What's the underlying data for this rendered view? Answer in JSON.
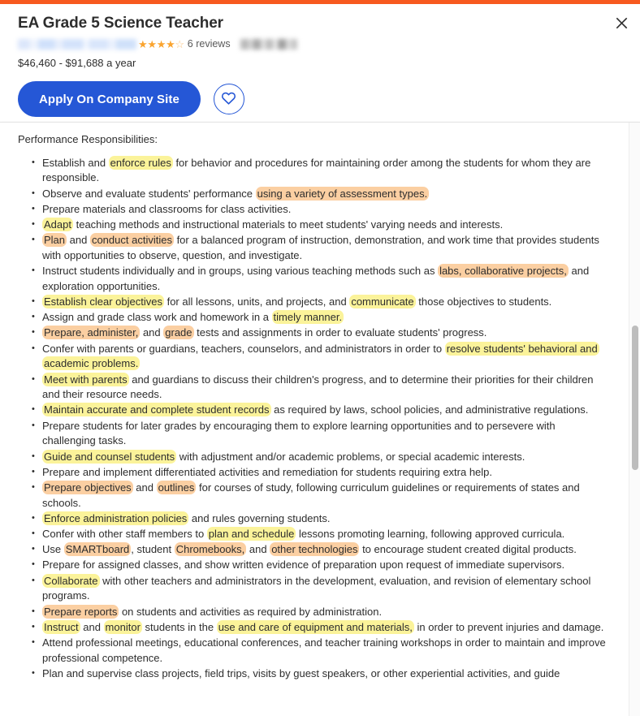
{
  "header": {
    "accent_color": "#f7591f",
    "job_title": "EA Grade 5 Science Teacher",
    "company_name_redacted": "",
    "location_redacted": "",
    "rating_stars": "★★★★",
    "rating_empty_star": "☆",
    "reviews_label": "6 reviews",
    "salary": "$46,460 - $91,688 a year",
    "apply_label": "Apply On Company Site",
    "apply_color": "#2557d6",
    "save_icon": "heart-icon",
    "close_icon": "close-icon"
  },
  "description": {
    "heading": "Performance Responsibilities:",
    "highlight_yellow": "#fbf39a",
    "highlight_orange": "#fbcfa2",
    "bullets": [
      [
        {
          "t": "Establish and ",
          "h": "none"
        },
        {
          "t": "enforce rules",
          "h": "yellow"
        },
        {
          "t": " for behavior and procedures for maintaining order among the students for whom they are responsible.",
          "h": "none"
        }
      ],
      [
        {
          "t": "Observe and evaluate students' performance ",
          "h": "none"
        },
        {
          "t": "using a variety of assessment types.",
          "h": "orange"
        }
      ],
      [
        {
          "t": "Prepare materials and classrooms for class activities.",
          "h": "none"
        }
      ],
      [
        {
          "t": "Adapt",
          "h": "yellow"
        },
        {
          "t": " teaching methods and instructional materials to meet students' varying needs and interests.",
          "h": "none"
        }
      ],
      [
        {
          "t": "Plan",
          "h": "orange"
        },
        {
          "t": " and ",
          "h": "none"
        },
        {
          "t": "conduct activities",
          "h": "orange"
        },
        {
          "t": " for a balanced program of instruction, demonstration, and work time that provides students with opportunities to observe, question, and investigate.",
          "h": "none"
        }
      ],
      [
        {
          "t": "Instruct students individually and in groups, using various teaching methods such as ",
          "h": "none"
        },
        {
          "t": "labs, collaborative projects,",
          "h": "orange"
        },
        {
          "t": " and exploration opportunities.",
          "h": "none"
        }
      ],
      [
        {
          "t": "Establish clear objectives",
          "h": "yellow"
        },
        {
          "t": " for all lessons, units, and projects, and ",
          "h": "none"
        },
        {
          "t": "communicate",
          "h": "yellow"
        },
        {
          "t": " those objectives to students.",
          "h": "none"
        }
      ],
      [
        {
          "t": "Assign and grade class work and homework in a ",
          "h": "none"
        },
        {
          "t": "timely manner.",
          "h": "yellow"
        }
      ],
      [
        {
          "t": "Prepare, administer,",
          "h": "orange"
        },
        {
          "t": " and ",
          "h": "none"
        },
        {
          "t": "grade",
          "h": "orange"
        },
        {
          "t": " tests and assignments in order to evaluate students' progress.",
          "h": "none"
        }
      ],
      [
        {
          "t": "Confer with parents or guardians, teachers, counselors, and administrators in order to ",
          "h": "none"
        },
        {
          "t": "resolve students' behavioral and academic problems.",
          "h": "yellow"
        }
      ],
      [
        {
          "t": "Meet with parents",
          "h": "yellow"
        },
        {
          "t": " and guardians to discuss their children's progress, and to determine their priorities for their children and their resource needs.",
          "h": "none"
        }
      ],
      [
        {
          "t": "Maintain accurate and complete student records",
          "h": "yellow"
        },
        {
          "t": " as required by laws, school policies, and administrative regulations.",
          "h": "none"
        }
      ],
      [
        {
          "t": "Prepare students for later grades by encouraging them to explore learning opportunities and to persevere with challenging tasks.",
          "h": "none"
        }
      ],
      [
        {
          "t": "Guide and counsel students",
          "h": "yellow"
        },
        {
          "t": " with adjustment and/or academic problems, or special academic interests.",
          "h": "none"
        }
      ],
      [
        {
          "t": "Prepare and implement differentiated activities and remediation for students requiring extra help.",
          "h": "none"
        }
      ],
      [
        {
          "t": "Prepare objectives",
          "h": "orange"
        },
        {
          "t": " and ",
          "h": "none"
        },
        {
          "t": "outlines",
          "h": "orange"
        },
        {
          "t": " for courses of study, following curriculum guidelines or requirements of states and schools.",
          "h": "none"
        }
      ],
      [
        {
          "t": "Enforce administration policies",
          "h": "yellow"
        },
        {
          "t": " and rules governing students.",
          "h": "none"
        }
      ],
      [
        {
          "t": "Confer with other staff members to ",
          "h": "none"
        },
        {
          "t": "plan and schedule",
          "h": "yellow"
        },
        {
          "t": " lessons promoting learning, following approved curricula.",
          "h": "none"
        }
      ],
      [
        {
          "t": "Use ",
          "h": "none"
        },
        {
          "t": "SMARTboard",
          "h": "orange"
        },
        {
          "t": ", student ",
          "h": "none"
        },
        {
          "t": "Chromebooks,",
          "h": "orange"
        },
        {
          "t": " and ",
          "h": "none"
        },
        {
          "t": "other technologies",
          "h": "orange"
        },
        {
          "t": " to encourage student created digital products.",
          "h": "none"
        }
      ],
      [
        {
          "t": "Prepare for assigned classes, and show written evidence of preparation upon request of immediate supervisors.",
          "h": "none"
        }
      ],
      [
        {
          "t": "Collaborate",
          "h": "yellow"
        },
        {
          "t": " with other teachers and administrators in the development, evaluation, and revision of elementary school programs.",
          "h": "none"
        }
      ],
      [
        {
          "t": "Prepare reports",
          "h": "orange"
        },
        {
          "t": " on students and activities as required by administration.",
          "h": "none"
        }
      ],
      [
        {
          "t": "Instruct",
          "h": "yellow"
        },
        {
          "t": " and ",
          "h": "none"
        },
        {
          "t": "monitor",
          "h": "yellow"
        },
        {
          "t": " students in the ",
          "h": "none"
        },
        {
          "t": "use and care of equipment and materials,",
          "h": "yellow"
        },
        {
          "t": " in order to prevent injuries and damage.",
          "h": "none"
        }
      ],
      [
        {
          "t": "Attend professional meetings, educational conferences, and teacher training workshops in order to maintain and improve professional competence.",
          "h": "none"
        }
      ],
      [
        {
          "t": "Plan and supervise class projects, field trips, visits by guest speakers, or other experiential activities, and guide",
          "h": "none"
        }
      ]
    ]
  }
}
